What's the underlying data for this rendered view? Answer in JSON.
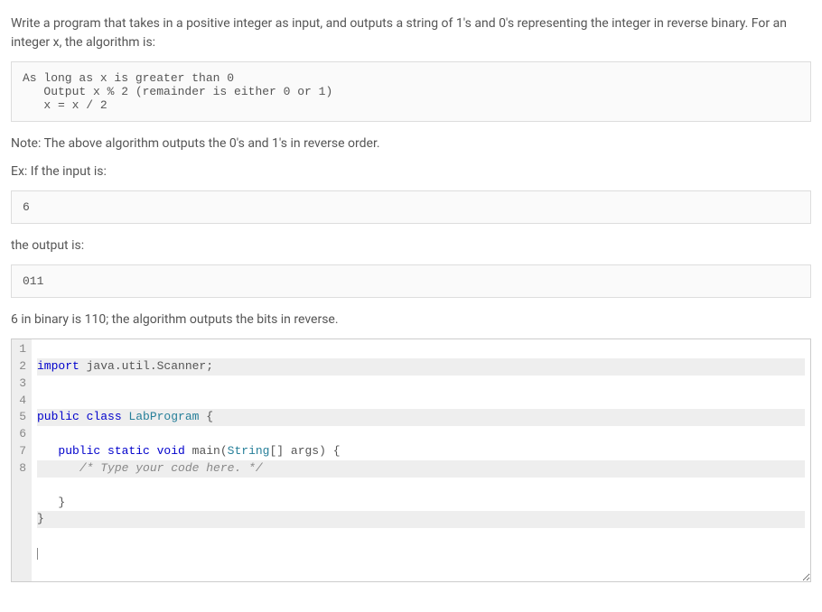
{
  "intro": "Write a program that takes in a positive integer as input, and outputs a string of 1's and 0's representing the integer in reverse binary. For an integer x, the algorithm is:",
  "algorithm": {
    "line1": "As long as x is greater than 0",
    "line2": "   Output x % 2 (remainder is either 0 or 1)",
    "line3": "   x = x / 2"
  },
  "note": "Note: The above algorithm outputs the 0's and 1's in reverse order.",
  "ex_label": "Ex: If the input is:",
  "input_example": "6",
  "output_label": "the output is:",
  "output_example": "011",
  "explain": "6 in binary is 110; the algorithm outputs the bits in reverse.",
  "code": {
    "line1_import": "import",
    "line1_rest": " java.util.Scanner;",
    "line2": "",
    "line3_public": "public",
    "line3_class": " class",
    "line3_name": " LabProgram",
    "line3_brace": " {",
    "line4_indent": "   ",
    "line4_mods": "public static void",
    "line4_main": " main",
    "line4_sig1": "(",
    "line4_type": "String",
    "line4_sig2": "[] args) {",
    "line5_indent": "      ",
    "line5_comment": "/* Type your code here. */",
    "line6": "   }",
    "line7": "}",
    "line8": ""
  },
  "line_numbers": [
    "1",
    "2",
    "3",
    "4",
    "5",
    "6",
    "7",
    "8"
  ]
}
